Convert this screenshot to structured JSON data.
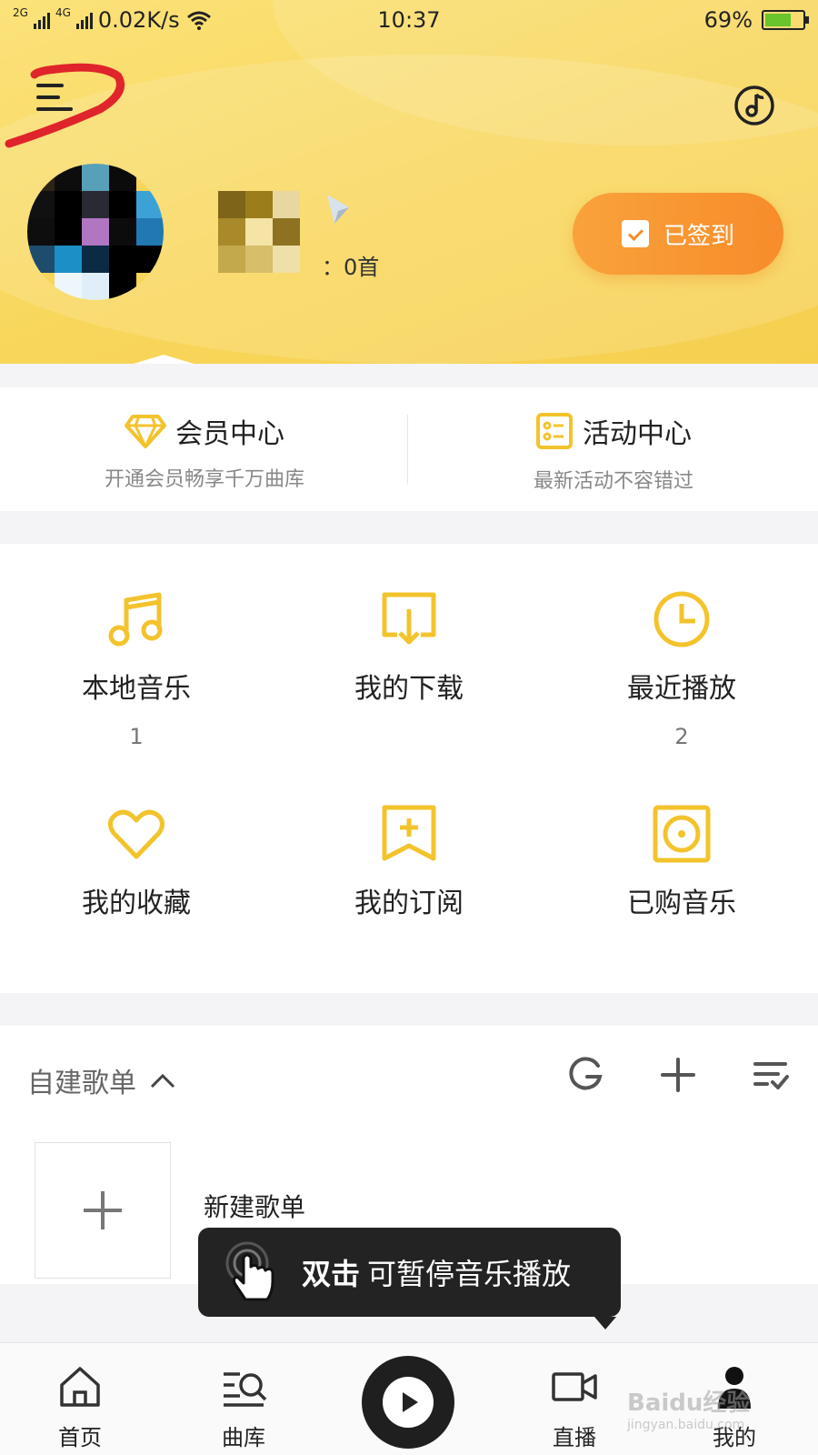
{
  "status_bar": {
    "net1": "2G",
    "net2": "4G",
    "speed": "0.02K/s",
    "time": "10:37",
    "battery_percent": "69%",
    "battery_level": 0.69
  },
  "header": {
    "song_count": "：0首",
    "checkin_label": "已签到"
  },
  "center": {
    "member": {
      "title": "会员中心",
      "subtitle": "开通会员畅享千万曲库"
    },
    "activity": {
      "title": "活动中心",
      "subtitle": "最新活动不容错过"
    }
  },
  "grid": [
    {
      "label": "本地音乐",
      "count": "1",
      "icon": "music-note-icon"
    },
    {
      "label": "我的下载",
      "count": "",
      "icon": "download-icon"
    },
    {
      "label": "最近播放",
      "count": "2",
      "icon": "clock-icon"
    },
    {
      "label": "我的收藏",
      "count": "",
      "icon": "heart-icon"
    },
    {
      "label": "我的订阅",
      "count": "",
      "icon": "bookmark-plus-icon"
    },
    {
      "label": "已购音乐",
      "count": "",
      "icon": "disc-icon"
    }
  ],
  "playlist": {
    "section_title": "自建歌单",
    "new_label": "新建歌单"
  },
  "toast": {
    "bold": "双击",
    "text": "可暂停音乐播放"
  },
  "bottom_nav": [
    {
      "label": "首页",
      "icon": "home-icon"
    },
    {
      "label": "曲库",
      "icon": "library-search-icon"
    },
    {
      "label": "",
      "icon": "play-icon"
    },
    {
      "label": "直播",
      "icon": "video-camera-icon"
    },
    {
      "label": "我的",
      "icon": "user-icon"
    }
  ],
  "watermark": {
    "text": "Baidu经验",
    "sub": "jingyan.baidu.com"
  },
  "colors": {
    "header_yellow": "#f8d65a",
    "accent_yellow": "#f3c32c",
    "checkin_orange": "#f78c2a",
    "toast_bg": "#232323"
  }
}
